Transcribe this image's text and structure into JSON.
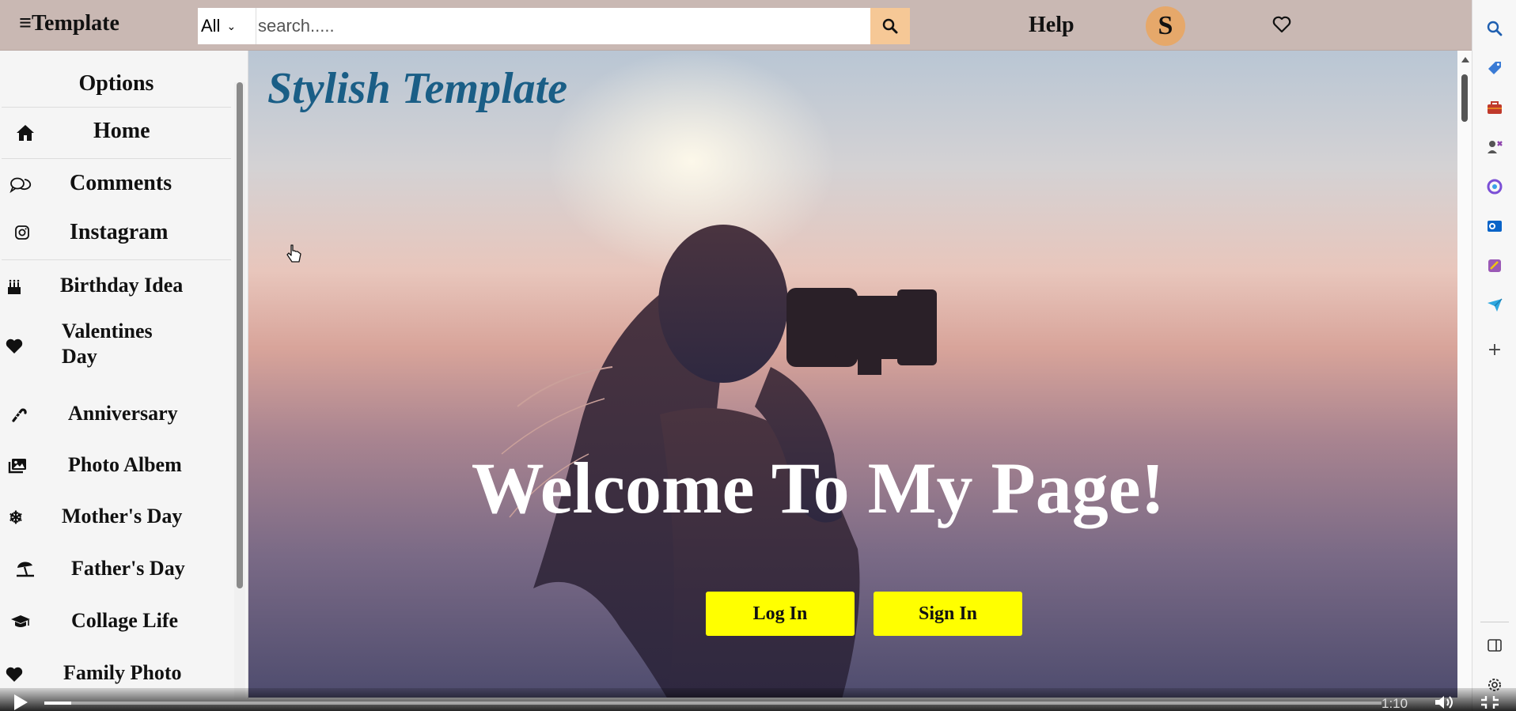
{
  "header": {
    "brand": "≡Template",
    "search_category": "All",
    "search_placeholder": "search.....",
    "help_label": "Help",
    "avatar_letter": "S"
  },
  "sidebar": {
    "heading": "Options",
    "items": [
      {
        "label": "Home",
        "icon": "home-icon"
      },
      {
        "label": "Comments",
        "icon": "comments-icon"
      },
      {
        "label": "Instagram",
        "icon": "instagram-icon"
      },
      {
        "label": "Birthday Idea",
        "icon": "cake-icon"
      },
      {
        "label": "Valentines",
        "label2": "Day",
        "icon": "heart-icon"
      },
      {
        "label": "Anniversary",
        "icon": "candy-cane-icon"
      },
      {
        "label": "Photo Albem",
        "icon": "photo-album-icon"
      },
      {
        "label": "Mother's Day",
        "icon": "snowflake-icon"
      },
      {
        "label": "Father's Day",
        "icon": "umbrella-beach-icon"
      },
      {
        "label": "Collage Life",
        "icon": "graduation-cap-icon"
      },
      {
        "label": "Family Photo",
        "icon": "heart-icon"
      }
    ]
  },
  "hero": {
    "title": "Stylish Template",
    "welcome": "Welcome To My Page!",
    "login_label": "Log In",
    "signin_label": "Sign In"
  },
  "video": {
    "time": "1:10",
    "progress": 0.02
  },
  "colors": {
    "topbar": "#c9b8b3",
    "search_button": "#f6c896",
    "avatar": "#e6a86a",
    "hero_title": "#1a5e86",
    "cta_button": "#ffff00"
  },
  "browser_sidebar_icons": [
    "search-icon",
    "tag-icon",
    "briefcase-icon",
    "games-icon",
    "copilot-icon",
    "outlook-icon",
    "designer-icon",
    "send-icon",
    "add-icon",
    "split-view-icon",
    "settings-icon"
  ]
}
